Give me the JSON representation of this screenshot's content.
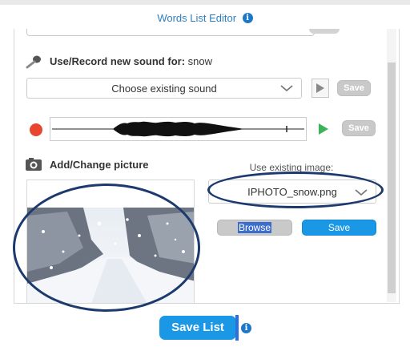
{
  "editor": {
    "title": "Words List Editor"
  },
  "sound": {
    "section_label": "Use/Record new sound for:",
    "word": "snow",
    "select_value": "Choose existing sound",
    "save_label": "Save",
    "record_save_label": "Save"
  },
  "picture": {
    "section_label": "Add/Change picture",
    "existing_label": "Use existing image:",
    "select_value": "IPHOTO_snow.png",
    "browse_label": "Browse",
    "save_label": "Save"
  },
  "footer": {
    "save_list_label": "Save List"
  },
  "colors": {
    "accent": "#1a98e6",
    "title": "#2f7fc0",
    "annotation": "#1d3a6e",
    "record": "#e8462f",
    "play_green": "#3cb35a"
  },
  "icons": [
    "info-icon",
    "microphone-icon",
    "picture-icon",
    "chevron-down-icon",
    "play-icon",
    "record-icon"
  ]
}
